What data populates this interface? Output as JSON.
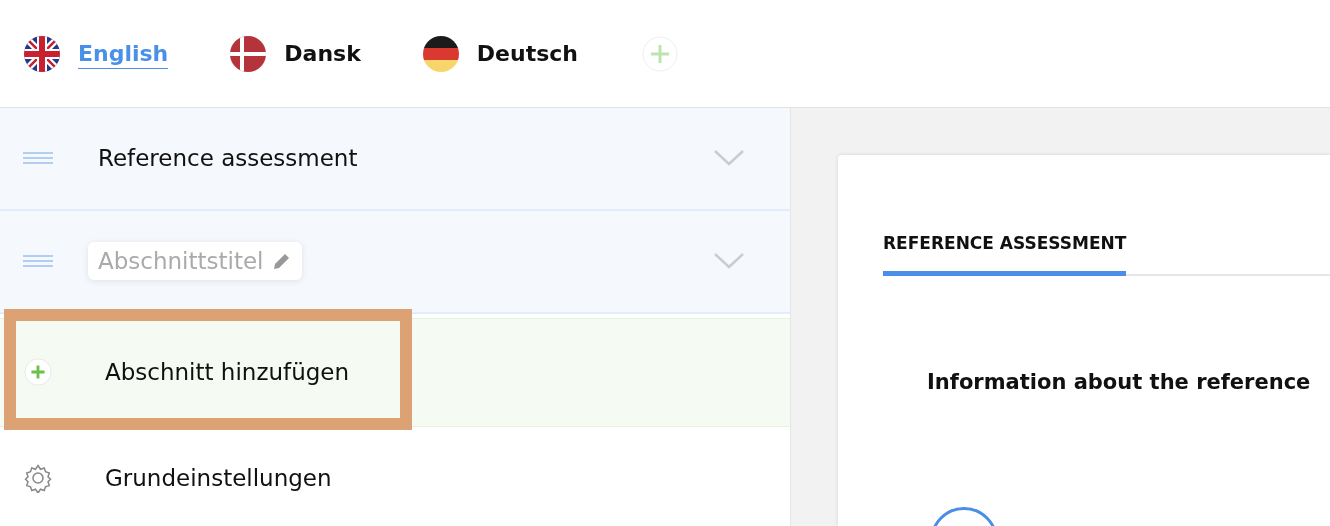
{
  "languages": [
    {
      "label": "English",
      "kind": "uk",
      "selected": true
    },
    {
      "label": "Dansk",
      "kind": "dk",
      "selected": false
    },
    {
      "label": "Deutsch",
      "kind": "de",
      "selected": false
    }
  ],
  "sections": [
    {
      "title": "Reference assessment",
      "editable": false
    },
    {
      "title": "Abschnittstitel",
      "editable": true
    }
  ],
  "add_section": {
    "label": "Abschnitt hinzufügen",
    "highlighted": true
  },
  "settings": {
    "label": "Grundeinstellungen"
  },
  "preview": {
    "tabs": [
      {
        "label": "REFERENCE ASSESSMENT",
        "selected": true
      }
    ],
    "heading": "Information about the reference"
  }
}
